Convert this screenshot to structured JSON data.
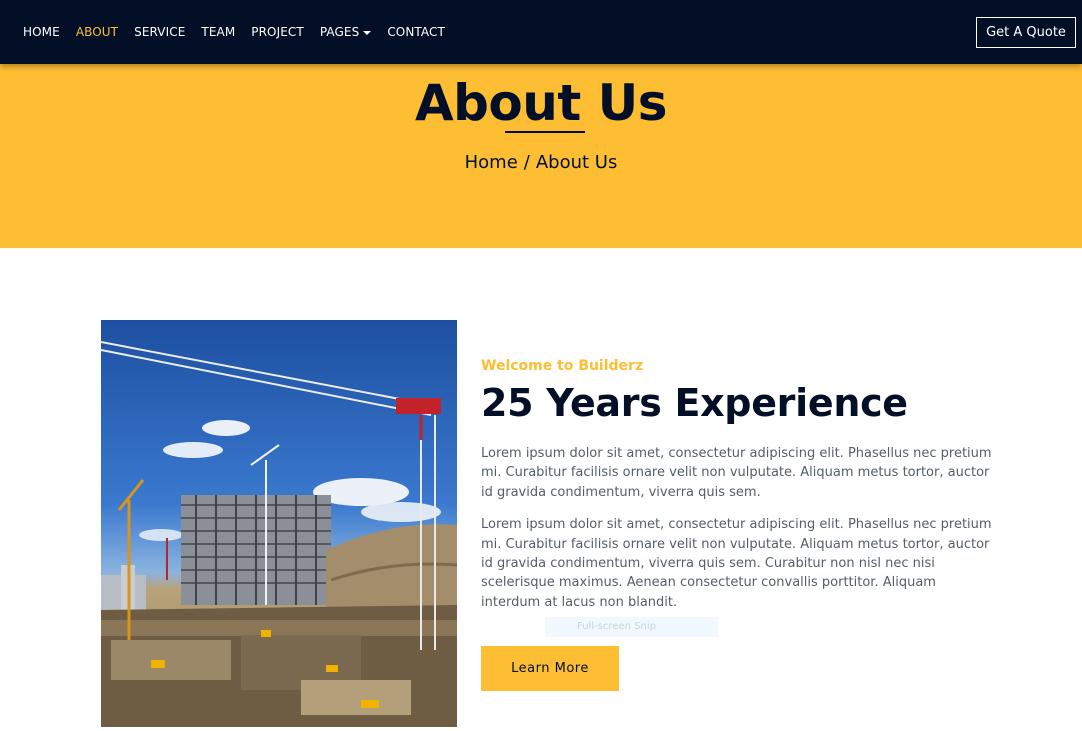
{
  "nav": {
    "items": [
      {
        "label": "HOME",
        "active": false
      },
      {
        "label": "ABOUT",
        "active": true
      },
      {
        "label": "SERVICE",
        "active": false
      },
      {
        "label": "TEAM",
        "active": false
      },
      {
        "label": "PROJECT",
        "active": false
      },
      {
        "label": "PAGES",
        "active": false,
        "dropdown": true
      },
      {
        "label": "CONTACT",
        "active": false
      }
    ],
    "quote_button": "Get A Quote"
  },
  "header": {
    "title": "About Us",
    "breadcrumb": [
      "Home",
      "About Us"
    ],
    "breadcrumb_separator": "/"
  },
  "about": {
    "subtitle": "Welcome to Builderz",
    "heading": "25 Years Experience",
    "paragraphs": [
      "Lorem ipsum dolor sit amet, consectetur adipiscing elit. Phasellus nec pretium mi. Curabitur facilisis ornare velit non vulputate. Aliquam metus tortor, auctor id gravida condimentum, viverra quis sem.",
      "Lorem ipsum dolor sit amet, consectetur adipiscing elit. Phasellus nec pretium mi. Curabitur facilisis ornare velit non vulputate. Aliquam metus tortor, auctor id gravida condimentum, viverra quis sem. Curabitur non nisl nec nisi scelerisque maximus. Aenean consectetur convallis porttitor. Aliquam interdum at lacus non blandit."
    ],
    "button": "Learn More",
    "image_alt": "construction-site-with-cranes"
  },
  "overlay": {
    "snip_text": "Full-screen Snip"
  },
  "colors": {
    "navy": "#030f27",
    "accent": "#fdbe33",
    "text": "#555e69"
  }
}
